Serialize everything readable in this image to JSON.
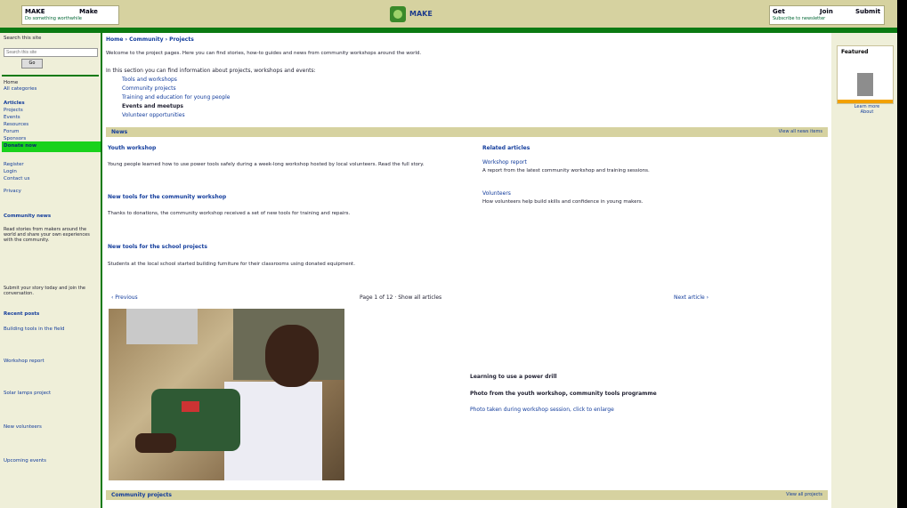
{
  "header": {
    "left_box": {
      "title": "MAKE",
      "title2": "Make",
      "subtitle": "Do something worthwhile"
    },
    "logo_text": "MAKE",
    "right_box": {
      "title": "Get",
      "title2": "Join",
      "title3": "Submit",
      "subtitle": "Subscribe to newsletter"
    }
  },
  "sidebar": {
    "top_label": "Search this site",
    "search_placeholder": "Search this site",
    "go_label": "Go",
    "section_label": "Home",
    "links": [
      "All categories",
      "Articles",
      "Projects",
      "Events",
      "Resources",
      "Forum",
      "Sponsors",
      "Donate now"
    ],
    "links2": [
      "Register",
      "Login",
      "Contact us",
      "Privacy"
    ],
    "community_heading": "Community news",
    "community_text": "Read stories from makers around the world and share your own experiences with the community.",
    "community_text2": "Submit your story today and join the conversation.",
    "recent_heading": "Recent posts",
    "recent_items": [
      "Building tools in the field",
      "Workshop report",
      "Solar lamps project",
      "New volunteers",
      "Upcoming events"
    ]
  },
  "rightcol": {
    "ad_title": "Featured",
    "ad_links": [
      "Learn more",
      "About"
    ]
  },
  "main": {
    "breadcrumb": "Home › Community › Projects",
    "intro": "Welcome to the project pages. Here you can find stories, how-to guides and news from community workshops around the world.",
    "list_intro": "In this section you can find information about projects, workshops and events:",
    "list": [
      "Tools and workshops",
      "Community projects",
      "Training and education for young people",
      "Events and meetups",
      "Volunteer opportunities"
    ],
    "news_section": {
      "title": "News",
      "right": "View all news items"
    },
    "articles": [
      {
        "title": "Youth workshop",
        "text": "Young people learned how to use power tools safely during a week-long workshop hosted by local volunteers. Read the full story."
      },
      {
        "title": "New tools for the community workshop",
        "text": "Thanks to donations, the community workshop received a set of new tools for training and repairs."
      },
      {
        "title": "New tools for the school projects",
        "text": "Students at the local school started building furniture for their classrooms using donated equipment."
      }
    ],
    "related": {
      "heading": "Related articles",
      "items": [
        {
          "title": "Workshop report",
          "text": "A report from the latest community workshop and training sessions."
        },
        {
          "title": "Volunteers",
          "text": "How volunteers help build skills and confidence in young makers."
        }
      ]
    },
    "nav": {
      "prev": "‹ Previous",
      "center": "Page 1 of 12 · Show all articles",
      "next": "Next article ›"
    },
    "caption": {
      "line1": "Learning to use a power drill",
      "line2": "Photo from the youth workshop, community tools programme",
      "line3": "Photo taken during workshop session, click to enlarge"
    },
    "bottom_section": {
      "title": "Community projects",
      "right": "View all projects"
    }
  }
}
